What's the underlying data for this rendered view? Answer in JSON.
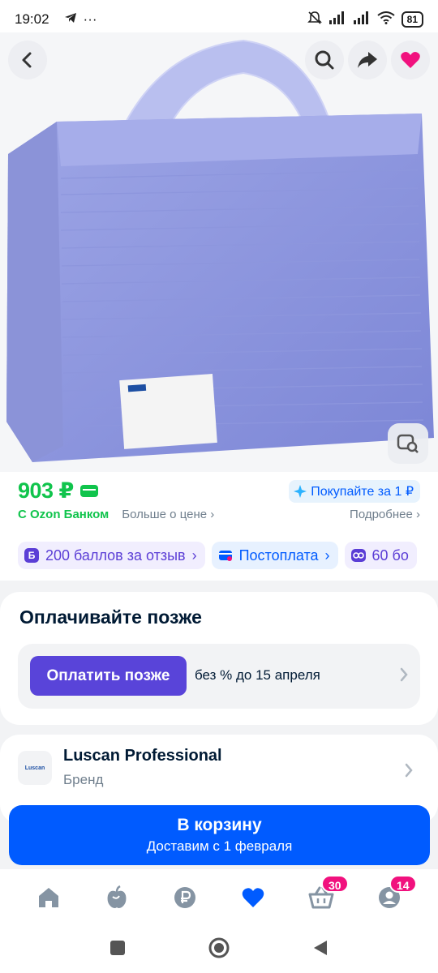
{
  "status_bar": {
    "time": "19:02",
    "dots": "···",
    "battery": "81"
  },
  "product": {
    "image_alt": "Blue paper towels pack",
    "label_title": "Luscan Professional"
  },
  "price": {
    "value": "903 ₽",
    "promo": "Покупайте за 1 ₽",
    "bank": "С Ozon Банком",
    "more": "Больше о цене",
    "details": "Подробнее"
  },
  "chips": [
    {
      "badge": "Б",
      "label": "200 баллов за отзыв"
    },
    {
      "badge": "",
      "label": "Постоплата"
    },
    {
      "badge": "",
      "label": "60 бо"
    }
  ],
  "pay_later": {
    "title": "Оплачивайте позже",
    "button": "Оплатить позже",
    "description": "без % до 15 апреля"
  },
  "brand": {
    "logo_text": "Luscan",
    "name": "Luscan Professional",
    "label": "Бренд"
  },
  "cart": {
    "label": "В корзину",
    "delivery": "Доставим с 1 февраля"
  },
  "nav": {
    "cart_badge": "30",
    "profile_badge": "14"
  },
  "colors": {
    "price_green": "#10c44c",
    "ozon_blue": "#005bff",
    "pay_purple": "#5944d9",
    "badge_pink": "#f1117e"
  }
}
